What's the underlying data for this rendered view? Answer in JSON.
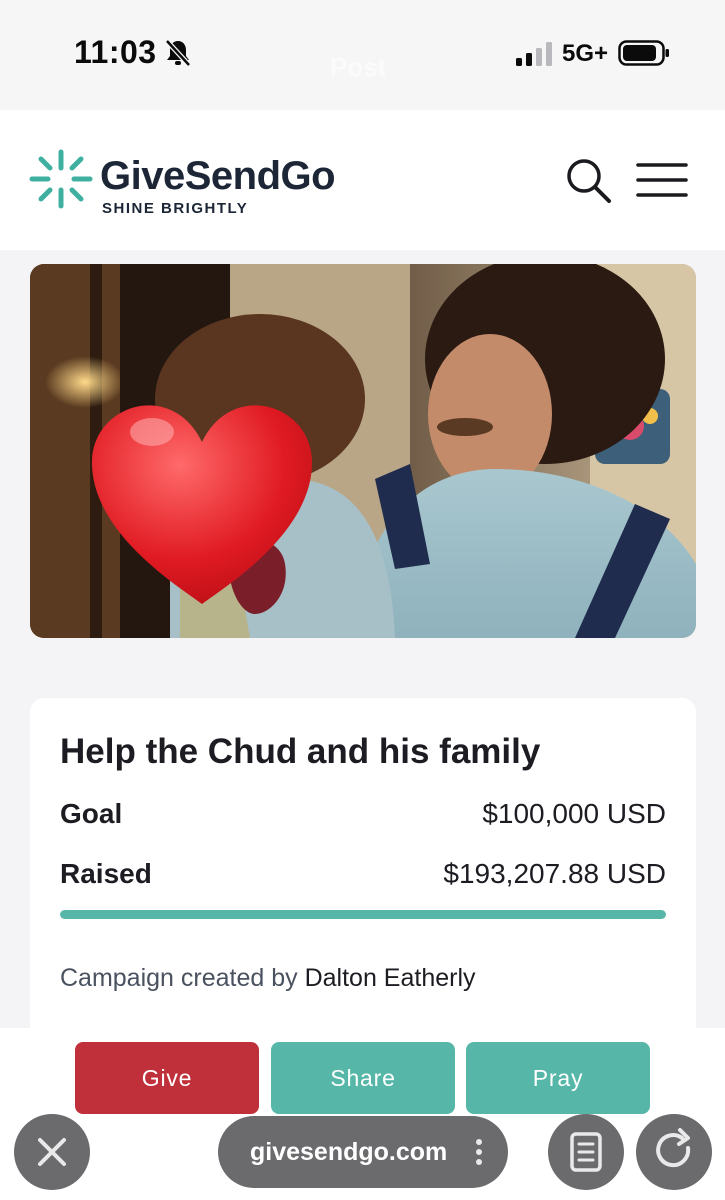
{
  "status_bar": {
    "time": "11:03",
    "network": "5G+",
    "icons": [
      "bell-slash-icon",
      "signal-icon",
      "battery-icon"
    ],
    "behind_text": "Post"
  },
  "header": {
    "brand_name": "GiveSendGo",
    "brand_tagline": "SHINE BRIGHTLY",
    "icons": [
      "logo-burst-icon",
      "search-icon",
      "hamburger-menu-icon"
    ],
    "brand_color": "#1c2636",
    "accent_color": "#56b7a8"
  },
  "campaign": {
    "title": "Help the Chud and his family",
    "goal_label": "Goal",
    "goal_value": "$100,000 USD",
    "raised_label": "Raised",
    "raised_value": "$193,207.88 USD",
    "progress_fraction": 1.0,
    "creator_prefix": "Campaign created by",
    "creator_name": "Dalton Eatherly"
  },
  "actions": {
    "give_label": "Give",
    "share_label": "Share",
    "pray_label": "Pray",
    "give_color": "#c0303a",
    "share_color": "#56b7a8",
    "pray_color": "#56b7a8"
  },
  "browser": {
    "url": "givesendgo.com",
    "icons": [
      "close-icon",
      "more-vertical-icon",
      "reader-icon",
      "reload-icon"
    ]
  }
}
